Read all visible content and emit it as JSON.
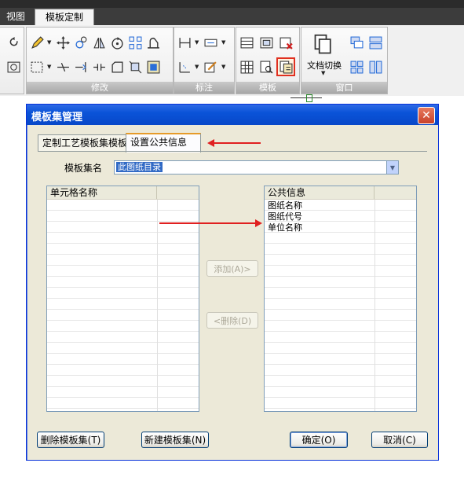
{
  "ribbon": {
    "tabs": [
      {
        "label": "视图"
      },
      {
        "label": "模板定制"
      }
    ],
    "panels": {
      "modify": "修改",
      "dimension": "标注",
      "template": "模板",
      "window": "窗口"
    },
    "doc_switch_label": "文档切换"
  },
  "dialog": {
    "title": "模板集管理",
    "tabs": [
      "定制工艺模板集模板",
      "设置公共信息"
    ],
    "active_tab": 1,
    "template_set_label": "模板集名",
    "template_set_value": "此图纸目录",
    "left_list": {
      "header": "单元格名称",
      "items": []
    },
    "right_list": {
      "header": "公共信息",
      "items": [
        "图纸名称",
        "图纸代号",
        "单位名称"
      ]
    },
    "buttons": {
      "add": "添加(A)>",
      "remove": "<删除(D)",
      "delete_set": "删除模板集(T)",
      "new_set": "新建模板集(N)",
      "ok": "确定(O)",
      "cancel": "取消(C)"
    }
  },
  "colors": {
    "annotation_arrow": "#e02020",
    "highlight": "#e03020",
    "titlebar": "#0a53d8"
  }
}
